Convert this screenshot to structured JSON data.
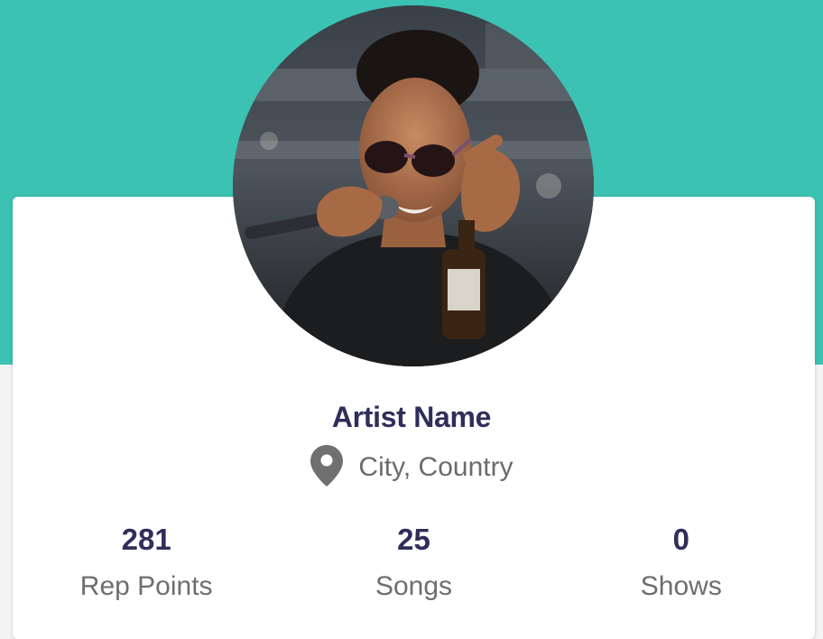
{
  "colors": {
    "header_background": "#3cc2b2",
    "accent_text": "#2f2e5a",
    "muted_text": "#6b6b6b",
    "icon_gray": "#707070"
  },
  "profile": {
    "avatar_icon": "artist-photo",
    "name": "Artist Name",
    "location": "City, Country",
    "location_icon": "map-pin-icon"
  },
  "stats": [
    {
      "value": "281",
      "label": "Rep Points"
    },
    {
      "value": "25",
      "label": "Songs"
    },
    {
      "value": "0",
      "label": "Shows"
    }
  ]
}
